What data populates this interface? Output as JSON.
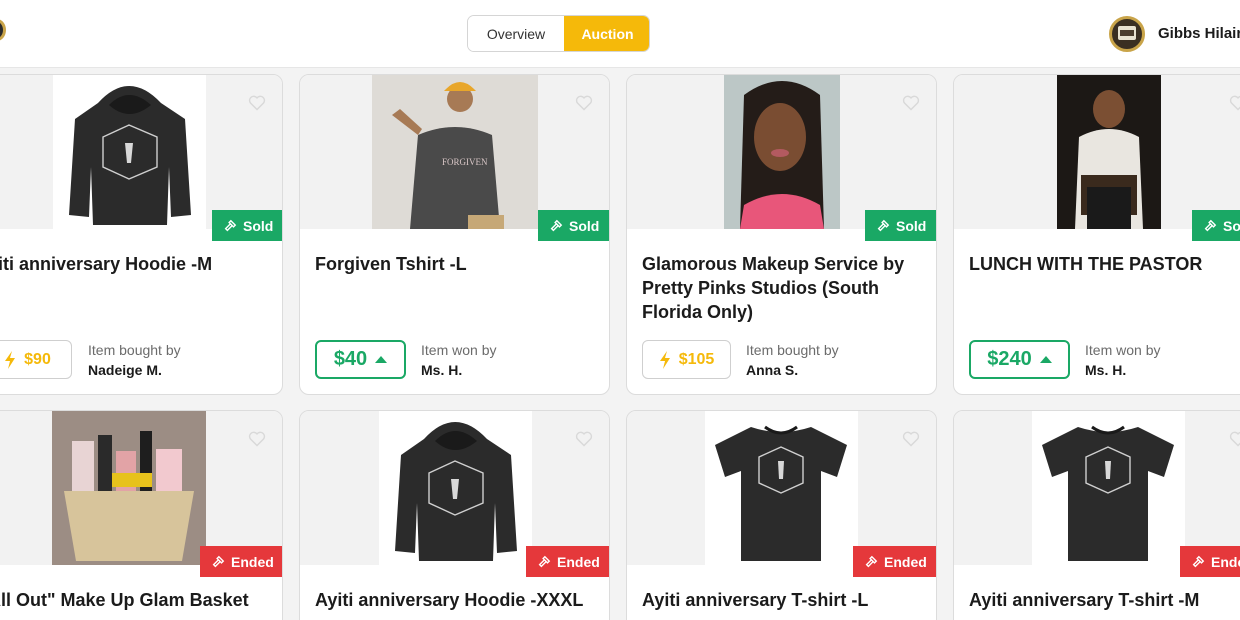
{
  "header": {
    "tabs": [
      {
        "label": "Overview",
        "active": false
      },
      {
        "label": "Auction",
        "active": true
      }
    ],
    "user_name": "Gibbs Hilair"
  },
  "colors": {
    "accent": "#f5b90a",
    "sold": "#1aa865",
    "ended": "#e5383b"
  },
  "items": [
    {
      "title": "yiti anniversary Hoodie -M",
      "status": "Sold",
      "price": "$90",
      "price_style": "buy-now",
      "buyer_label": "Item bought by",
      "buyer": "Nadeige M."
    },
    {
      "title": "Forgiven Tshirt -L",
      "status": "Sold",
      "price": "$40",
      "price_style": "winning-bid",
      "buyer_label": "Item won by",
      "buyer": "Ms. H."
    },
    {
      "title": "Glamorous Makeup Service by Pretty Pinks Studios (South Florida Only)",
      "status": "Sold",
      "price": "$105",
      "price_style": "buy-now",
      "buyer_label": "Item bought by",
      "buyer": "Anna S."
    },
    {
      "title": "LUNCH WITH THE PASTOR",
      "status": "So",
      "price": "$240",
      "price_style": "winning-bid",
      "buyer_label": "Item won by",
      "buyer": "Ms. H."
    },
    {
      "title": "All Out\" Make Up Glam Basket",
      "status": "Ended"
    },
    {
      "title": "Ayiti anniversary Hoodie -XXXL",
      "status": "Ended"
    },
    {
      "title": "Ayiti anniversary T-shirt -L",
      "status": "Ended"
    },
    {
      "title": "Ayiti anniversary T-shirt -M",
      "status": "Ende"
    }
  ],
  "icons": {
    "favorite": "heart-outline-icon",
    "status": "gavel-icon",
    "buy_now": "lightning-bolt-icon",
    "winning_bid": "caret-up-icon"
  }
}
